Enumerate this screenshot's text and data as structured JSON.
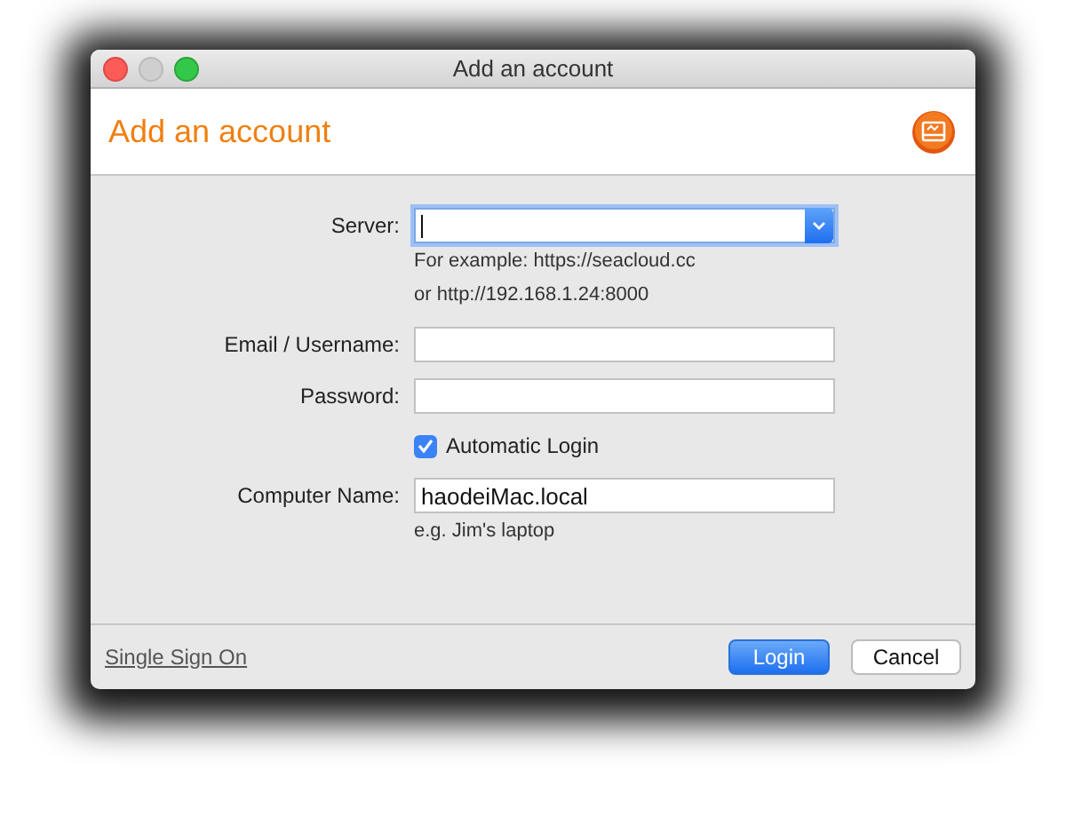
{
  "window": {
    "title": "Add an account"
  },
  "header": {
    "title": "Add an account"
  },
  "form": [
    {
      "kind": "combo",
      "label": "Server:",
      "focused": true
    },
    {
      "kind": "hint",
      "text": "For example: https://seacloud.cc"
    },
    {
      "kind": "hint",
      "text": "or http://192.168.1.24:8000"
    },
    {
      "kind": "text",
      "label": "Email / Username:",
      "focused": false
    },
    {
      "kind": "password",
      "label": "Password:",
      "focused": false
    },
    {
      "kind": "checkbox",
      "text": "Automatic Login",
      "checked": true
    },
    {
      "kind": "text",
      "label": "Computer Name:",
      "value": "haodeiMac.local",
      "focused": false
    },
    {
      "kind": "hint",
      "text": "e.g. Jim's laptop"
    }
  ],
  "footer": {
    "link": "Single Sign On",
    "buttons": [
      {
        "label": "Login",
        "default": true
      },
      {
        "label": "Cancel",
        "default": false
      }
    ]
  }
}
